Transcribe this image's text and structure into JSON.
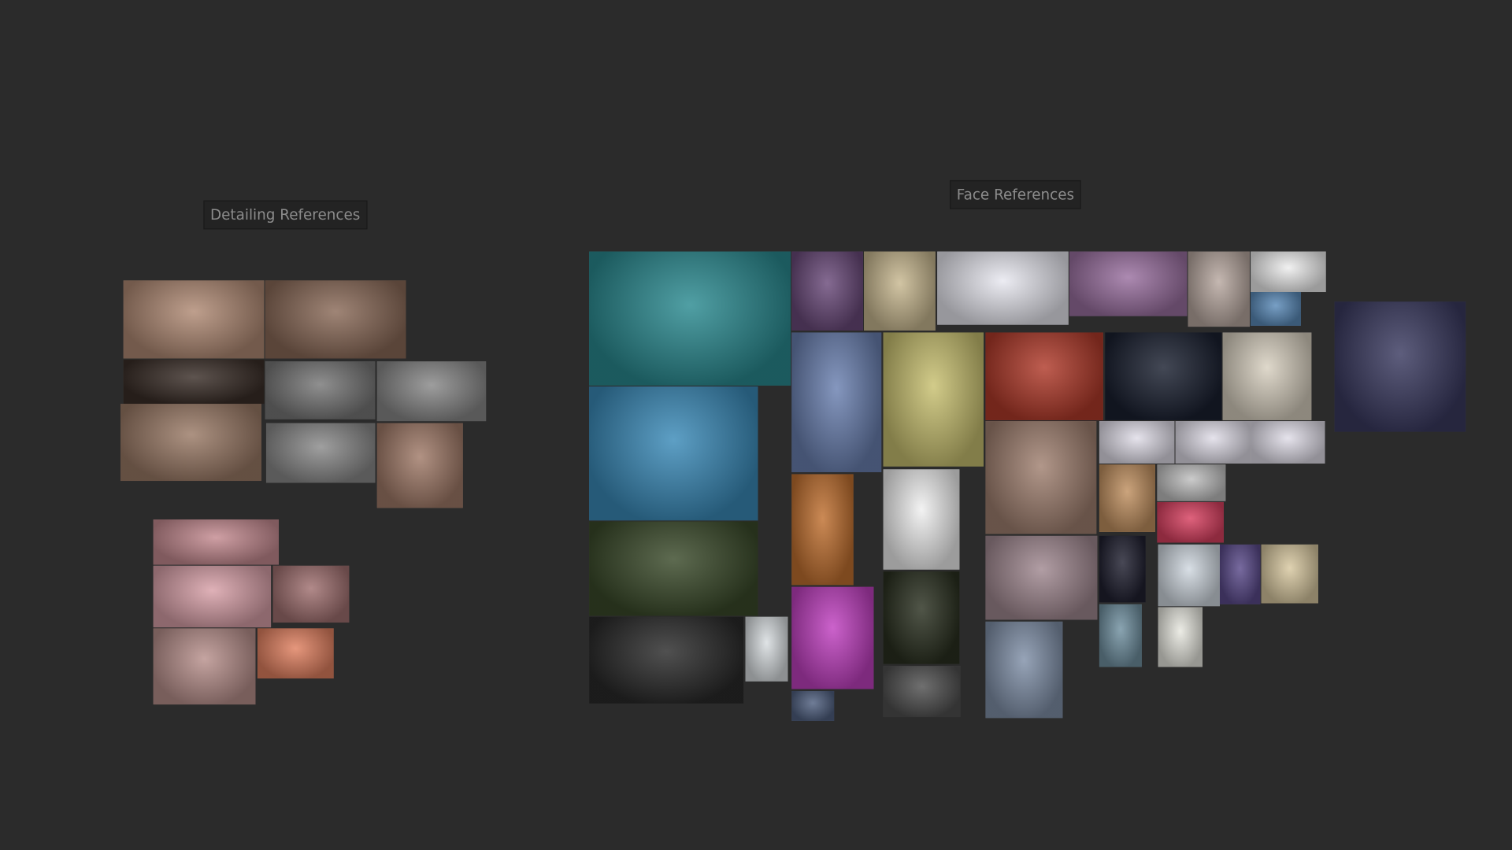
{
  "groups": {
    "detailing": {
      "title": "Detailing References"
    },
    "face": {
      "title": "Face References"
    }
  },
  "colors": {
    "background": "#2b2b2b",
    "label_bg": "#232323",
    "label_text": "#8c8c8c"
  },
  "detailing_images": [
    "#b08a74",
    "#8a6a58",
    "#3a2e28",
    "#777777",
    "#888888",
    "#9a7a66",
    "#8a8a8a",
    "#a07a68",
    "#c48a90",
    "#d8a0a8",
    "#a07070",
    "#b8908c",
    "#e08060"
  ],
  "face_images": [
    "#2a8a90",
    "#3a8ab8",
    "#3a4a2a",
    "#2a2a2a",
    "#d8dde0",
    "#6a4a7a",
    "#c8b890",
    "#e8e8f0",
    "#9a70a0",
    "#b8a8a0",
    "#eeeeee",
    "#5a8ab8",
    "#3a3a60",
    "#6a80b0",
    "#c8c070",
    "#b03a2a",
    "#1a2030",
    "#d8d0c0",
    "#a08070",
    "#e0dde8",
    "#e0dde8",
    "#e0dde8",
    "#c09060",
    "#c0c0c0",
    "#d84060",
    "#c07030",
    "#f0f0f0",
    "#a08890",
    "#202030",
    "#d0d8e0",
    "#5a4a8a",
    "#d8c8a0",
    "#c040c0",
    "#2a3020",
    "#8090a8",
    "#7090a0",
    "#e8e8e0",
    "#506080",
    "#505050"
  ]
}
